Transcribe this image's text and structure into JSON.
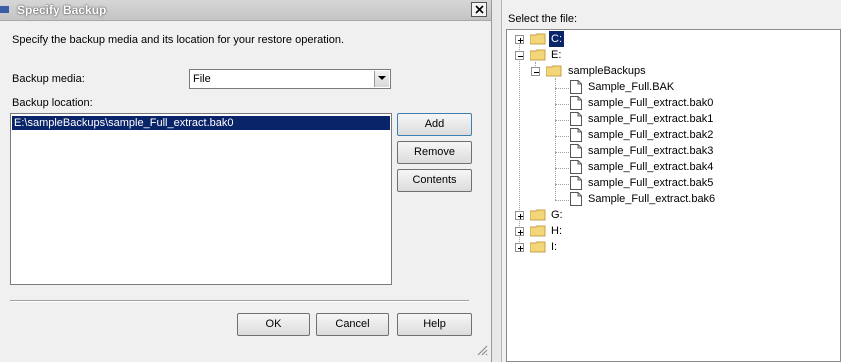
{
  "dialog": {
    "title": "Specify Backup",
    "intro": "Specify the backup media and its location for your restore operation.",
    "media_label": "Backup media:",
    "media_value": "File",
    "location_label": "Backup location:",
    "locations": [
      "E:\\sampleBackups\\sample_Full_extract.bak0"
    ],
    "buttons": {
      "add": "Add",
      "remove": "Remove",
      "contents": "Contents",
      "ok": "OK",
      "cancel": "Cancel",
      "help": "Help"
    }
  },
  "file_browser": {
    "label": "Select the file:",
    "drives": [
      "C:",
      "E:",
      "G:",
      "H:",
      "I:"
    ],
    "folder": "sampleBackups",
    "files": [
      "Sample_Full.BAK",
      "sample_Full_extract.bak0",
      "sample_Full_extract.bak1",
      "sample_Full_extract.bak2",
      "sample_Full_extract.bak3",
      "sample_Full_extract.bak4",
      "sample_Full_extract.bak5",
      "Sample_Full_extract.bak6"
    ],
    "selected": "C:"
  },
  "colors": {
    "selection": "#0a246a",
    "folder": "#f3d57a",
    "window_bg": "#f0f0f0"
  }
}
